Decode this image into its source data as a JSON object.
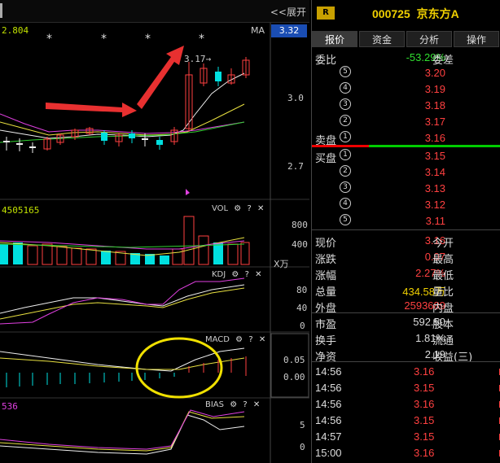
{
  "chart": {
    "expand_label": "<<展开",
    "ma_value": "2.804",
    "ma_label": "MA",
    "current_price_label": "3.32",
    "price_annotation": "3.17→",
    "price_axis": [
      "3.0",
      "2.7"
    ],
    "vol_value": "4505165",
    "vol_title": "VOL",
    "vol_axis": [
      "800",
      "400"
    ],
    "vol_unit": "X万",
    "kdj_title": "KDJ",
    "kdj_axis": [
      "80",
      "40",
      "0"
    ],
    "macd_title": "MACD",
    "macd_axis": [
      "0.05",
      "0.00"
    ],
    "bias_value": "536",
    "bias_title": "BIAS",
    "bias_axis": [
      "5",
      "0"
    ],
    "title_icons": [
      "gear-icon",
      "help-icon",
      "close-icon"
    ]
  },
  "quote": {
    "badge": "R",
    "stock_code": "000725",
    "stock_name": "京东方A",
    "tabs": [
      "报价",
      "资金",
      "分析",
      "操作"
    ],
    "weibi_label": "委比",
    "weibi_value": "-53.29%",
    "weicha_label": "委差",
    "sell": [
      {
        "level": "5",
        "price": "3.20"
      },
      {
        "level": "4",
        "price": "3.19"
      },
      {
        "level": "3",
        "price": "3.18"
      },
      {
        "level": "2",
        "price": "3.17"
      },
      {
        "level": "1",
        "price": "3.16"
      }
    ],
    "sell_label": "卖盘",
    "buy_label": "买盘",
    "buy": [
      {
        "level": "1",
        "price": "3.15"
      },
      {
        "level": "2",
        "price": "3.14"
      },
      {
        "level": "3",
        "price": "3.13"
      },
      {
        "level": "4",
        "price": "3.12"
      },
      {
        "level": "5",
        "price": "3.11"
      }
    ],
    "stats": [
      {
        "l1": "现价",
        "v": "3.16",
        "l2": "今开",
        "color": "#ff4040"
      },
      {
        "l1": "涨跌",
        "v": "0.07",
        "l2": "最高",
        "color": "#ff4040"
      },
      {
        "l1": "涨幅",
        "v": "2.27%",
        "l2": "最低",
        "color": "#ff4040"
      },
      {
        "l1": "总量",
        "v": "434.58万",
        "l2": "量比",
        "color": "#f0d000"
      },
      {
        "l1": "外盘",
        "v": "2593689",
        "l2": "内盘",
        "color": "#ff4040"
      }
    ],
    "stats2": [
      {
        "l1": "市盈",
        "v": "592.50",
        "l2": "股本",
        "color": "#ddd"
      },
      {
        "l1": "换手",
        "v": "1.81%",
        "l2": "流通",
        "color": "#ddd"
      },
      {
        "l1": "净资",
        "v": "2.19",
        "l2": "收益(三)",
        "color": "#ddd"
      }
    ],
    "ticks": [
      {
        "time": "14:56",
        "price": "3.16"
      },
      {
        "time": "14:56",
        "price": "3.15"
      },
      {
        "time": "14:56",
        "price": "3.16"
      },
      {
        "time": "14:56",
        "price": "3.15"
      },
      {
        "time": "14:57",
        "price": "3.15"
      },
      {
        "time": "15:00",
        "price": "3.16"
      }
    ]
  }
}
